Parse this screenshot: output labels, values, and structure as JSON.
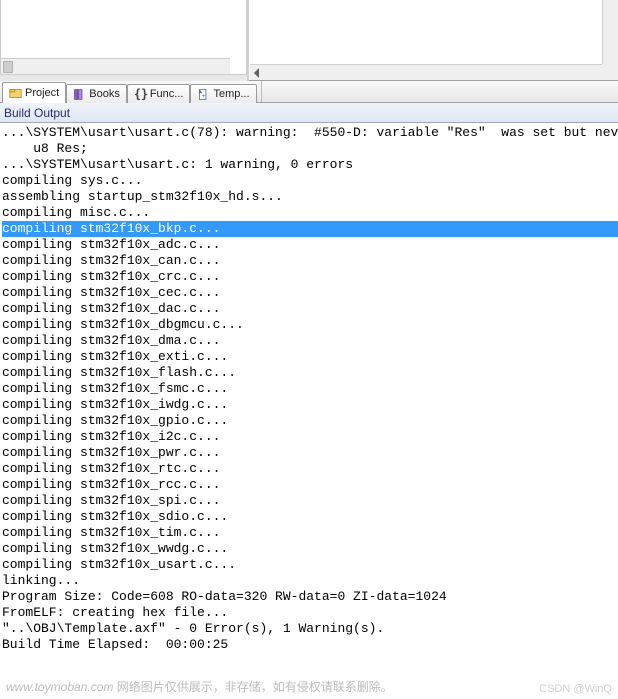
{
  "tabs": [
    {
      "label": "Project",
      "icon": "project"
    },
    {
      "label": "Books",
      "icon": "books"
    },
    {
      "label": "Func...",
      "icon": "functions"
    },
    {
      "label": "Temp...",
      "icon": "templates"
    }
  ],
  "active_tab_index": 0,
  "panel_title": "Build Output",
  "build_lines": [
    {
      "text": "...\\SYSTEM\\usart\\usart.c(78): warning:  #550-D: variable \"Res\"  was set but nev"
    },
    {
      "text": "    u8 Res;"
    },
    {
      "text": "...\\SYSTEM\\usart\\usart.c: 1 warning, 0 errors"
    },
    {
      "text": "compiling sys.c..."
    },
    {
      "text": "assembling startup_stm32f10x_hd.s..."
    },
    {
      "text": "compiling misc.c..."
    },
    {
      "text": "compiling stm32f10x_bkp.c...",
      "hl": true
    },
    {
      "text": "compiling stm32f10x_adc.c..."
    },
    {
      "text": "compiling stm32f10x_can.c..."
    },
    {
      "text": "compiling stm32f10x_crc.c..."
    },
    {
      "text": "compiling stm32f10x_cec.c..."
    },
    {
      "text": "compiling stm32f10x_dac.c..."
    },
    {
      "text": "compiling stm32f10x_dbgmcu.c..."
    },
    {
      "text": "compiling stm32f10x_dma.c..."
    },
    {
      "text": "compiling stm32f10x_exti.c..."
    },
    {
      "text": "compiling stm32f10x_flash.c..."
    },
    {
      "text": "compiling stm32f10x_fsmc.c..."
    },
    {
      "text": "compiling stm32f10x_iwdg.c..."
    },
    {
      "text": "compiling stm32f10x_gpio.c..."
    },
    {
      "text": "compiling stm32f10x_i2c.c..."
    },
    {
      "text": "compiling stm32f10x_pwr.c..."
    },
    {
      "text": "compiling stm32f10x_rtc.c..."
    },
    {
      "text": "compiling stm32f10x_rcc.c..."
    },
    {
      "text": "compiling stm32f10x_spi.c..."
    },
    {
      "text": "compiling stm32f10x_sdio.c..."
    },
    {
      "text": "compiling stm32f10x_tim.c..."
    },
    {
      "text": "compiling stm32f10x_wwdg.c..."
    },
    {
      "text": "compiling stm32f10x_usart.c..."
    },
    {
      "text": "linking..."
    },
    {
      "text": "Program Size: Code=608 RO-data=320 RW-data=0 ZI-data=1024"
    },
    {
      "text": "FromELF: creating hex file..."
    },
    {
      "text": "\"..\\OBJ\\Template.axf\" - 0 Error(s), 1 Warning(s)."
    },
    {
      "text": "Build Time Elapsed:  00:00:25"
    }
  ],
  "watermark_left": "www.toymoban.com",
  "watermark_text": "网络图片仅供展示，非存储，如有侵权请联系删除。",
  "watermark_right": "CSDN @WinQ"
}
